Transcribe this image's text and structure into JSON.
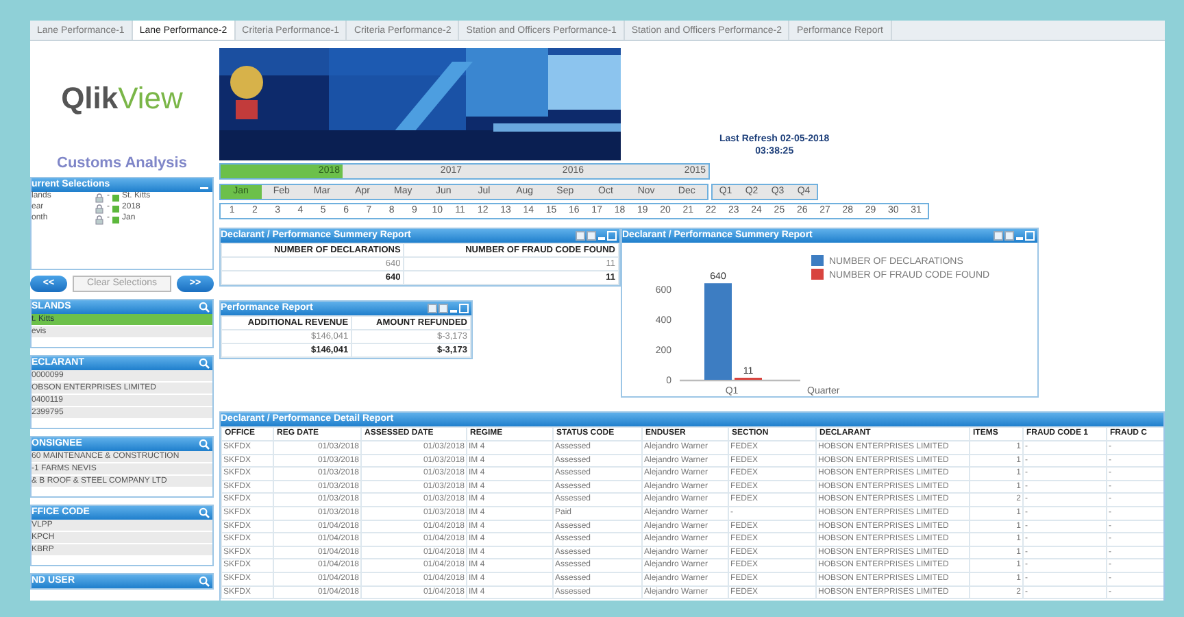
{
  "tabs": [
    {
      "label": "Lane Performance-1",
      "selected": false
    },
    {
      "label": "Lane Performance-2",
      "selected": true
    },
    {
      "label": "Criteria Performance-1",
      "selected": false
    },
    {
      "label": "Criteria Performance-2",
      "selected": false
    },
    {
      "label": "Station and Officers Performance-1",
      "selected": false
    },
    {
      "label": "Station and Officers Performance-2",
      "selected": false
    },
    {
      "label": "Performance Report",
      "selected": false
    }
  ],
  "sidebar": {
    "logo": [
      "Qlik",
      "View"
    ],
    "title": "Customs Analysis",
    "current_selections": {
      "title": "urrent Selections",
      "rows": [
        {
          "field": "lands",
          "separator": "-",
          "value": "St. Kitts"
        },
        {
          "field": "ear",
          "separator": "-",
          "value": "2018"
        },
        {
          "field": "onth",
          "separator": "-",
          "value": "Jan"
        }
      ]
    },
    "buttons": {
      "back": "<<",
      "clear": "Clear Selections",
      "forward": ">>"
    },
    "list_boxes": [
      {
        "title": "SLANDS",
        "items": [
          {
            "label": "t. Kitts",
            "selected": true
          },
          {
            "label": "evis",
            "selected": false
          }
        ]
      },
      {
        "title": "ECLARANT",
        "items": [
          {
            "label": "0000099",
            "selected": false
          },
          {
            "label": "OBSON ENTERPRISES LIMITED",
            "selected": false
          },
          {
            "label": "0400119",
            "selected": false
          },
          {
            "label": "2399795",
            "selected": false
          }
        ]
      },
      {
        "title": "ONSIGNEE",
        "items": [
          {
            "label": "60 MAINTENANCE & CONSTRUCTION",
            "selected": false
          },
          {
            "label": "-1 FARMS NEVIS",
            "selected": false
          },
          {
            "label": "& B ROOF & STEEL COMPANY LTD",
            "selected": false
          }
        ]
      },
      {
        "title": "FFICE CODE",
        "items": [
          {
            "label": "VLPP",
            "selected": false
          },
          {
            "label": "KPCH",
            "selected": false
          },
          {
            "label": "KBRP",
            "selected": false
          }
        ]
      },
      {
        "title": "ND USER"
      }
    ]
  },
  "header": {
    "last_refresh": "Last Refresh 02-05-2018",
    "refresh_time": "03:38:25"
  },
  "years": [
    {
      "label": "2018",
      "selected": true
    },
    {
      "label": "2017",
      "selected": false
    },
    {
      "label": "2016",
      "selected": false
    },
    {
      "label": "2015",
      "selected": false
    }
  ],
  "months": [
    {
      "label": "Jan",
      "selected": true
    },
    {
      "label": "Feb",
      "selected": false
    },
    {
      "label": "Mar",
      "selected": false
    },
    {
      "label": "Apr",
      "selected": false
    },
    {
      "label": "May",
      "selected": false
    },
    {
      "label": "Jun",
      "selected": false
    },
    {
      "label": "Jul",
      "selected": false
    },
    {
      "label": "Aug",
      "selected": false
    },
    {
      "label": "Sep",
      "selected": false
    },
    {
      "label": "Oct",
      "selected": false
    },
    {
      "label": "Nov",
      "selected": false
    },
    {
      "label": "Dec",
      "selected": false
    }
  ],
  "quarters": [
    {
      "label": "Q1",
      "selected": false
    },
    {
      "label": "Q2",
      "selected": false
    },
    {
      "label": "Q3",
      "selected": false
    },
    {
      "label": "Q4",
      "selected": false
    }
  ],
  "days": [
    "1",
    "2",
    "3",
    "4",
    "5",
    "6",
    "7",
    "8",
    "9",
    "10",
    "11",
    "12",
    "13",
    "14",
    "15",
    "16",
    "17",
    "18",
    "19",
    "20",
    "21",
    "22",
    "23",
    "24",
    "25",
    "26",
    "27",
    "28",
    "29",
    "30",
    "31"
  ],
  "summary_table": {
    "title": "Declarant / Performance Summery Report",
    "columns": [
      "NUMBER OF DECLARATIONS",
      "NUMBER OF FRAUD CODE FOUND"
    ],
    "rows": [
      [
        "640",
        "11"
      ]
    ],
    "totals": [
      "640",
      "11"
    ]
  },
  "performance_report": {
    "title": "Performance Report",
    "columns": [
      "ADDITIONAL REVENUE",
      "AMOUNT REFUNDED"
    ],
    "rows": [
      [
        "$146,041",
        "$-3,173"
      ]
    ],
    "totals": [
      "$146,041",
      "$-3,173"
    ]
  },
  "chart_panel": {
    "title": "Declarant / Performance Summery Report",
    "chart_data": {
      "type": "bar",
      "xlabel": "Quarter",
      "categories": [
        "Q1"
      ],
      "series": [
        {
          "name": "NUMBER OF DECLARATIONS",
          "color": "#3d7dc2",
          "values": [
            640
          ]
        },
        {
          "name": "NUMBER OF FRAUD CODE FOUND",
          "color": "#d8443f",
          "values": [
            11
          ]
        }
      ],
      "ylim": [
        0,
        650
      ],
      "yticks": [
        0,
        200,
        400,
        600
      ],
      "data_labels": true,
      "legend": "top-right"
    }
  },
  "detail_report": {
    "title": "Declarant / Performance Detail Report",
    "columns": [
      "OFFICE",
      "REG  DATE",
      "ASSESSED  DATE",
      "REGIME",
      "STATUS  CODE",
      "ENDUSER",
      "SECTION",
      "DECLARANT",
      "ITEMS",
      "FRAUD  CODE  1",
      "FRAUD  C"
    ],
    "rows": [
      [
        "SKFDX",
        "01/03/2018",
        "01/03/2018",
        "IM 4",
        "Assessed",
        "Alejandro Warner",
        "FEDEX",
        "HOBSON ENTERPRISES LIMITED",
        "1",
        "-",
        "-"
      ],
      [
        "SKFDX",
        "01/03/2018",
        "01/03/2018",
        "IM 4",
        "Assessed",
        "Alejandro Warner",
        "FEDEX",
        "HOBSON ENTERPRISES LIMITED",
        "1",
        "-",
        "-"
      ],
      [
        "SKFDX",
        "01/03/2018",
        "01/03/2018",
        "IM 4",
        "Assessed",
        "Alejandro Warner",
        "FEDEX",
        "HOBSON ENTERPRISES LIMITED",
        "1",
        "-",
        "-"
      ],
      [
        "SKFDX",
        "01/03/2018",
        "01/03/2018",
        "IM 4",
        "Assessed",
        "Alejandro Warner",
        "FEDEX",
        "HOBSON ENTERPRISES LIMITED",
        "1",
        "-",
        "-"
      ],
      [
        "SKFDX",
        "01/03/2018",
        "01/03/2018",
        "IM 4",
        "Assessed",
        "Alejandro Warner",
        "FEDEX",
        "HOBSON ENTERPRISES LIMITED",
        "2",
        "-",
        "-"
      ],
      [
        "SKFDX",
        "01/03/2018",
        "01/03/2018",
        "IM 4",
        "Paid",
        "Alejandro Warner",
        "-",
        "HOBSON ENTERPRISES LIMITED",
        "1",
        "-",
        "-"
      ],
      [
        "SKFDX",
        "01/04/2018",
        "01/04/2018",
        "IM 4",
        "Assessed",
        "Alejandro Warner",
        "FEDEX",
        "HOBSON ENTERPRISES LIMITED",
        "1",
        "-",
        "-"
      ],
      [
        "SKFDX",
        "01/04/2018",
        "01/04/2018",
        "IM 4",
        "Assessed",
        "Alejandro Warner",
        "FEDEX",
        "HOBSON ENTERPRISES LIMITED",
        "1",
        "-",
        "-"
      ],
      [
        "SKFDX",
        "01/04/2018",
        "01/04/2018",
        "IM 4",
        "Assessed",
        "Alejandro Warner",
        "FEDEX",
        "HOBSON ENTERPRISES LIMITED",
        "1",
        "-",
        "-"
      ],
      [
        "SKFDX",
        "01/04/2018",
        "01/04/2018",
        "IM 4",
        "Assessed",
        "Alejandro Warner",
        "FEDEX",
        "HOBSON ENTERPRISES LIMITED",
        "1",
        "-",
        "-"
      ],
      [
        "SKFDX",
        "01/04/2018",
        "01/04/2018",
        "IM 4",
        "Assessed",
        "Alejandro Warner",
        "FEDEX",
        "HOBSON ENTERPRISES LIMITED",
        "1",
        "-",
        "-"
      ],
      [
        "SKFDX",
        "01/04/2018",
        "01/04/2018",
        "IM 4",
        "Assessed",
        "Alejandro Warner",
        "FEDEX",
        "HOBSON ENTERPRISES LIMITED",
        "2",
        "-",
        "-"
      ]
    ]
  }
}
